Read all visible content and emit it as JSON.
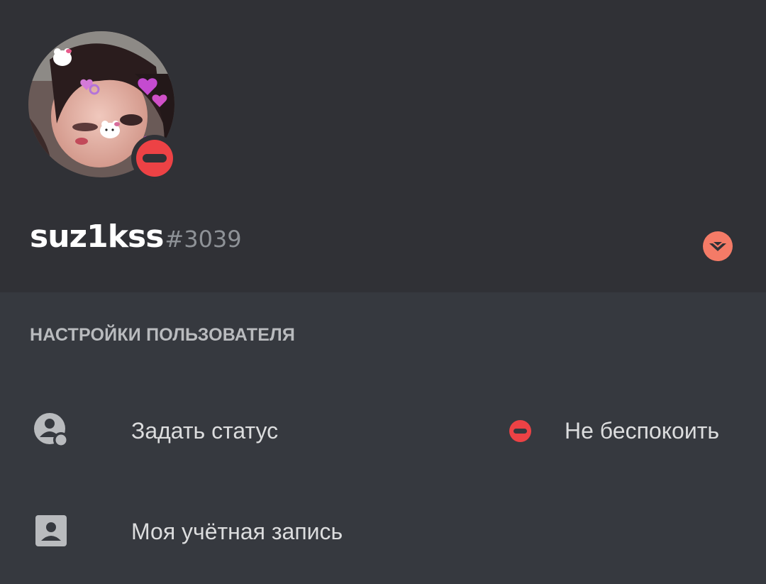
{
  "profile": {
    "username": "suz1kss",
    "discriminator": "#3039",
    "status": "dnd"
  },
  "icons": {
    "avatar": "avatar-image",
    "status": "do-not-disturb-icon",
    "badge": "nitro-badge-icon",
    "set_status": "user-status-icon",
    "account": "account-card-icon"
  },
  "colors": {
    "header_bg": "#303136",
    "body_bg": "#36393f",
    "dnd_red": "#ed4245",
    "nitro_badge": "#f47b67"
  },
  "settings": {
    "section_title": "НАСТРОЙКИ ПОЛЬЗОВАТЕЛЯ",
    "items": [
      {
        "label": "Задать статус",
        "value": "Не беспокоить"
      },
      {
        "label": "Моя учётная запись"
      }
    ]
  }
}
